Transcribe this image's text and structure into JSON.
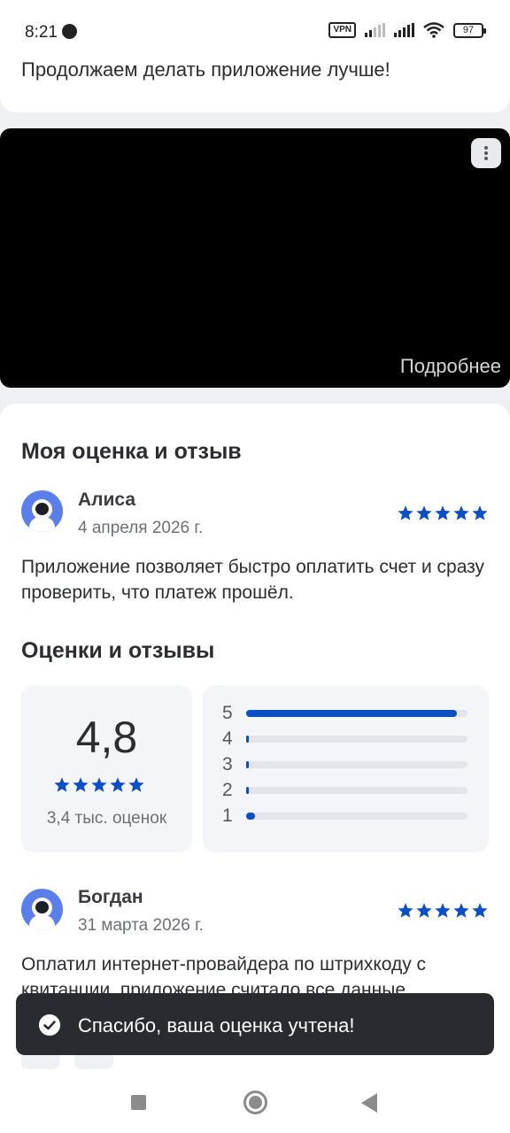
{
  "status_bar": {
    "time": "8:21",
    "vpn": "VPN",
    "battery": "97"
  },
  "top_card": {
    "text": "Продолжаем делать приложение лучше!"
  },
  "video": {
    "more_link": "Подробнее"
  },
  "my_review": {
    "title": "Моя оценка и отзыв",
    "name": "Алиса",
    "date": "4 апреля 2026 г.",
    "stars": 5,
    "text": "Приложение позволяет быстро оплатить счет и сразу проверить, что платеж прошёл."
  },
  "ratings": {
    "title": "Оценки и отзывы",
    "average": "4,8",
    "stars": 5,
    "count": "3,4 тыс. оценок",
    "distribution": [
      {
        "label": "5",
        "fraction": 0.95
      },
      {
        "label": "4",
        "fraction": 0.01
      },
      {
        "label": "3",
        "fraction": 0.01
      },
      {
        "label": "2",
        "fraction": 0.01
      },
      {
        "label": "1",
        "fraction": 0.04
      }
    ]
  },
  "review_2": {
    "name": "Богдан",
    "date": "31 марта 2026 г.",
    "stars": 5,
    "text": "Оплатил интернет-провайдера по штрихкоду с квитанции, приложение считало все данные"
  },
  "toast": {
    "text": "Спасибо, ваша оценка учтена!"
  },
  "colors": {
    "accent": "#0a4fc4",
    "toast_bg": "#2a2b30"
  }
}
